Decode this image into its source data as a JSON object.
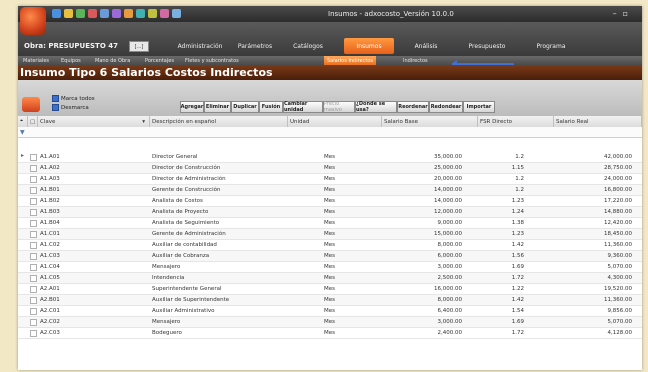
{
  "window": {
    "title": "Insumos - adxocosto_Versión 10.0.0"
  },
  "obra": {
    "label": "Obra: PRESUPUESTO 47",
    "button": "[...]"
  },
  "menu": [
    "Administración",
    "Parámetros",
    "Catálogos",
    "Insumos",
    "Análisis",
    "Presupuesto",
    "Programa"
  ],
  "menu_active": "Insumos",
  "subtabs": [
    "Materiales",
    "Equipos",
    "Mano de Obra",
    "Porcentajes",
    "Fletes y subcontratos",
    "Salarios Indirectos",
    "Indirectos"
  ],
  "subtab_active": "Salarios Indirectos",
  "section_title": "Insumo Tipo 6 Salarios Costos Indirectos",
  "toolbar": {
    "checks": [
      "Marca todos",
      "Desmarca"
    ],
    "buttons": [
      "Agregar",
      "Eliminar",
      "Duplicar",
      "Fusión",
      "Cambiar unidad",
      "Precio masivo",
      "¿Donde se usa?",
      "Reordenar",
      "Redondear",
      "Importar"
    ]
  },
  "columns": [
    "Clave",
    "Descripción en español",
    "Unidad",
    "Salario Base",
    "FSR Directo",
    "Salario Real"
  ],
  "rows": [
    {
      "clave": "A1.A01",
      "desc": "Director General",
      "unidad": "Mes",
      "base": "35,000.00",
      "fsr": "1.2",
      "real": "42,000.00"
    },
    {
      "clave": "A1.A02",
      "desc": "Director de Construcción",
      "unidad": "Mes",
      "base": "25,000.00",
      "fsr": "1.15",
      "real": "28,750.00"
    },
    {
      "clave": "A1.A03",
      "desc": "Director de Administración",
      "unidad": "Mes",
      "base": "20,000.00",
      "fsr": "1.2",
      "real": "24,000.00"
    },
    {
      "clave": "A1.B01",
      "desc": "Gerente de Construcción",
      "unidad": "Mes",
      "base": "14,000.00",
      "fsr": "1.2",
      "real": "16,800.00"
    },
    {
      "clave": "A1.B02",
      "desc": "Analista de Costos",
      "unidad": "Mes",
      "base": "14,000.00",
      "fsr": "1.23",
      "real": "17,220.00"
    },
    {
      "clave": "A1.B03",
      "desc": "Analista de Proyecto",
      "unidad": "Mes",
      "base": "12,000.00",
      "fsr": "1.24",
      "real": "14,880.00"
    },
    {
      "clave": "A1.B04",
      "desc": "Analista de Seguimiento",
      "unidad": "Mes",
      "base": "9,000.00",
      "fsr": "1.38",
      "real": "12,420.00"
    },
    {
      "clave": "A1.C01",
      "desc": "Gerente de Administración",
      "unidad": "Mes",
      "base": "15,000.00",
      "fsr": "1.23",
      "real": "18,450.00"
    },
    {
      "clave": "A1.C02",
      "desc": "Auxiliar de contabilidad",
      "unidad": "Mes",
      "base": "8,000.00",
      "fsr": "1.42",
      "real": "11,360.00"
    },
    {
      "clave": "A1.C03",
      "desc": "Auxiliar de Cobranza",
      "unidad": "Mes",
      "base": "6,000.00",
      "fsr": "1.56",
      "real": "9,360.00"
    },
    {
      "clave": "A1.C04",
      "desc": "Mensajero",
      "unidad": "Mes",
      "base": "3,000.00",
      "fsr": "1.69",
      "real": "5,070.00"
    },
    {
      "clave": "A1.C05",
      "desc": "Intendencia",
      "unidad": "Mes",
      "base": "2,500.00",
      "fsr": "1.72",
      "real": "4,300.00"
    },
    {
      "clave": "A2.A01",
      "desc": "Superintendente General",
      "unidad": "Mes",
      "base": "16,000.00",
      "fsr": "1.22",
      "real": "19,520.00"
    },
    {
      "clave": "A2.B01",
      "desc": "Auxiliar de Superintendente",
      "unidad": "Mes",
      "base": "8,000.00",
      "fsr": "1.42",
      "real": "11,360.00"
    },
    {
      "clave": "A2.C01",
      "desc": "Auxiliar Administrativo",
      "unidad": "Mes",
      "base": "6,400.00",
      "fsr": "1.54",
      "real": "9,856.00"
    },
    {
      "clave": "A2.C02",
      "desc": "Mensajero",
      "unidad": "Mes",
      "base": "3,000.00",
      "fsr": "1.69",
      "real": "5,070.00"
    },
    {
      "clave": "A2.C03",
      "desc": "Bodeguero",
      "unidad": "Mes",
      "base": "2,400.00",
      "fsr": "1.72",
      "real": "4,128.00"
    }
  ]
}
